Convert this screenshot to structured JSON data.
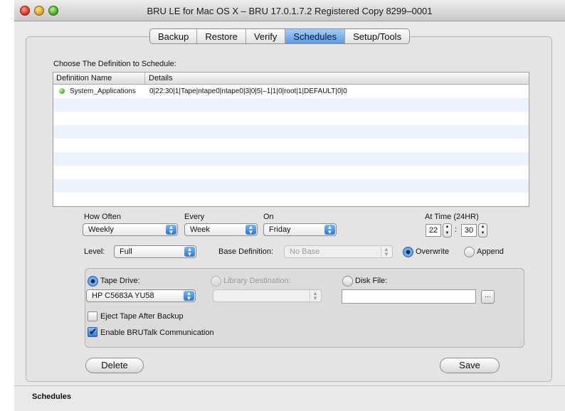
{
  "window": {
    "title": "BRU LE for Mac OS X – BRU 17.0.1.7.2 Registered Copy 8299–0001"
  },
  "tabs": [
    {
      "label": "Backup"
    },
    {
      "label": "Restore"
    },
    {
      "label": "Verify"
    },
    {
      "label": "Schedules",
      "active": true
    },
    {
      "label": "Setup/Tools"
    }
  ],
  "definition_list": {
    "prompt": "Choose The Definition to Schedule:",
    "columns": [
      "Definition Name",
      "Details"
    ],
    "rows": [
      {
        "name": "System_Applications",
        "details": "0|22:30|1|Tape|ntape0|ntape0|3|0|5|–1|1|0|root|1|DEFAULT|0|0",
        "status_color": "#3ea52b"
      }
    ]
  },
  "schedule": {
    "how_often": {
      "label": "How Often",
      "value": "Weekly"
    },
    "every": {
      "label": "Every",
      "value": "Week"
    },
    "on": {
      "label": "On",
      "value": "Friday"
    },
    "at_time": {
      "label": "At Time (24HR)",
      "hour": "22",
      "separator": ":",
      "minute": "30"
    },
    "level": {
      "label": "Level:",
      "value": "Full"
    },
    "base_definition": {
      "label": "Base Definition:",
      "value": "No Base"
    },
    "overwrite_label": "Overwrite",
    "append_label": "Append"
  },
  "destination": {
    "tape_drive": {
      "label": "Tape Drive:",
      "value": "HP C5683A YU58"
    },
    "library": {
      "label": "Library Destination:"
    },
    "disk_file": {
      "label": "Disk File:",
      "value": "",
      "browse": "..."
    },
    "eject_tape": {
      "label": "Eject Tape After Backup"
    },
    "brutalk": {
      "label": "Enable BRUTalk Communication"
    }
  },
  "buttons": {
    "delete": "Delete",
    "save": "Save"
  },
  "status": {
    "text": "Schedules"
  },
  "colors": {
    "tab_active": "#5a9be6",
    "row_stripe": "#edf3fe",
    "accent": "#2c7ddb"
  }
}
